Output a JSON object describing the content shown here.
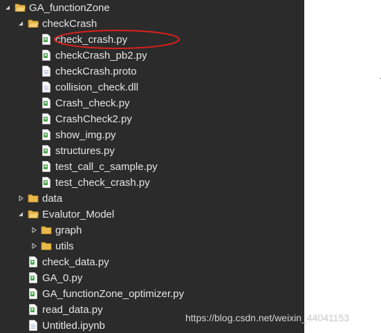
{
  "tree": [
    {
      "label": "GA_functionZone",
      "type": "folder",
      "expanded": true,
      "depth": 0
    },
    {
      "label": "checkCrash",
      "type": "folder",
      "expanded": true,
      "depth": 1
    },
    {
      "label": "check_crash.py",
      "type": "py",
      "depth": 2,
      "highlighted": true
    },
    {
      "label": "checkCrash_pb2.py",
      "type": "py",
      "depth": 2
    },
    {
      "label": "checkCrash.proto",
      "type": "file",
      "depth": 2
    },
    {
      "label": "collision_check.dll",
      "type": "file",
      "depth": 2
    },
    {
      "label": "Crash_check.py",
      "type": "py",
      "depth": 2
    },
    {
      "label": "CrashCheck2.py",
      "type": "py",
      "depth": 2
    },
    {
      "label": "show_img.py",
      "type": "py",
      "depth": 2
    },
    {
      "label": "structures.py",
      "type": "py",
      "depth": 2
    },
    {
      "label": "test_call_c_sample.py",
      "type": "py",
      "depth": 2
    },
    {
      "label": "test_check_crash.py",
      "type": "py",
      "depth": 2
    },
    {
      "label": "data",
      "type": "folder",
      "expanded": false,
      "depth": 1
    },
    {
      "label": "Evalutor_Model",
      "type": "folder",
      "expanded": true,
      "depth": 1
    },
    {
      "label": "graph",
      "type": "folder",
      "expanded": false,
      "depth": 2
    },
    {
      "label": "utils",
      "type": "folder",
      "expanded": false,
      "depth": 2
    },
    {
      "label": "check_data.py",
      "type": "py",
      "depth": 1
    },
    {
      "label": "GA_0.py",
      "type": "py",
      "depth": 1
    },
    {
      "label": "GA_functionZone_optimizer.py",
      "type": "py",
      "depth": 1
    },
    {
      "label": "read_data.py",
      "type": "py",
      "depth": 1
    },
    {
      "label": "Untitled.ipynb",
      "type": "file",
      "depth": 1
    }
  ],
  "icons": {
    "folder": "folder-icon",
    "py": "python-file-icon",
    "file": "file-icon"
  },
  "colors": {
    "panel_bg": "#2b2b2b",
    "text": "#e6e6e6",
    "folder": "#e8b84a",
    "py_green": "#4fa64f",
    "highlight_circle": "#e0201c"
  },
  "watermark": "https://blog.csdn.net/weixin_44041153",
  "stray_mark": "."
}
